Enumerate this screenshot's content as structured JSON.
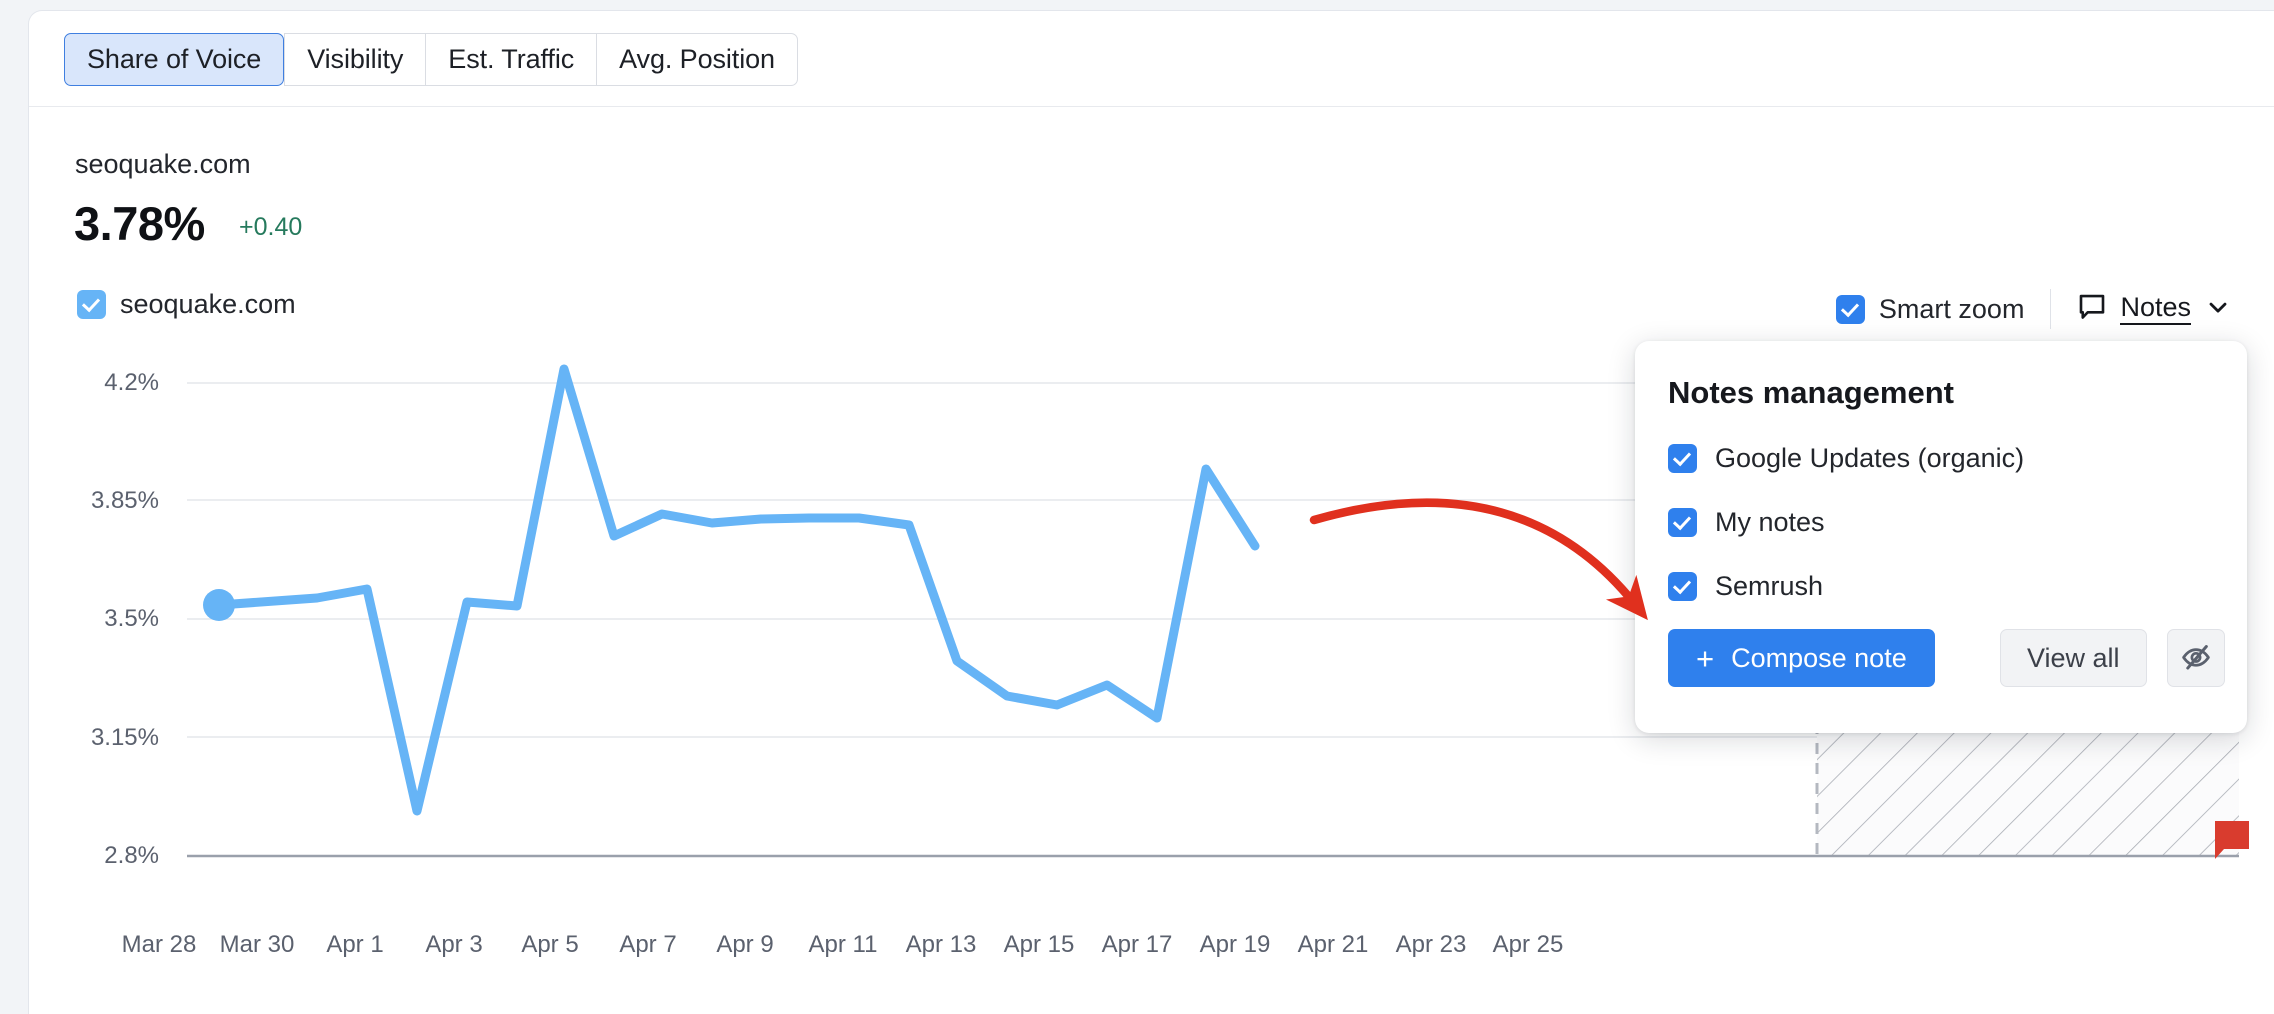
{
  "tabs": [
    {
      "label": "Share of Voice",
      "active": true
    },
    {
      "label": "Visibility",
      "active": false
    },
    {
      "label": "Est. Traffic",
      "active": false
    },
    {
      "label": "Avg. Position",
      "active": false
    }
  ],
  "header": {
    "domain": "seoquake.com",
    "value": "3.78%",
    "delta": "+0.40"
  },
  "legend": {
    "series_label": "seoquake.com",
    "smart_zoom_label": "Smart zoom",
    "notes_label": "Notes"
  },
  "notes_popup": {
    "title": "Notes management",
    "options": [
      {
        "label": "Google Updates (organic)",
        "checked": true
      },
      {
        "label": "My notes",
        "checked": true
      },
      {
        "label": "Semrush",
        "checked": true
      }
    ],
    "compose_label": "Compose note",
    "compose_plus": "+",
    "view_all_label": "View all"
  },
  "colors": {
    "line": "#66b4f6",
    "accent_blue": "#2f80ed",
    "active_tab_bg": "#d9e6fb",
    "active_tab_border": "#3f7fe0",
    "delta_green": "#267a5d",
    "annotation_red": "#e0301e",
    "note_marker_red": "#d93c2e"
  },
  "chart_data": {
    "type": "line",
    "title": "",
    "xlabel": "",
    "ylabel": "",
    "ylim": [
      2.8,
      4.2
    ],
    "yticks": [
      "2.8%",
      "3.15%",
      "3.5%",
      "3.85%",
      "4.2%"
    ],
    "ytick_values": [
      2.8,
      3.15,
      3.5,
      3.85,
      4.2
    ],
    "xticks": [
      "Mar 28",
      "Mar 30",
      "Apr 1",
      "Apr 3",
      "Apr 5",
      "Apr 7",
      "Apr 9",
      "Apr 11",
      "Apr 13",
      "Apr 15",
      "Apr 17",
      "Apr 19",
      "Apr 21",
      "Apr 23",
      "Apr 25"
    ],
    "grid": true,
    "legend_position": "top-left",
    "series": [
      {
        "name": "seoquake.com",
        "color": "#66b4f6",
        "x": [
          "Mar 28",
          "Mar 29",
          "Mar 30",
          "Mar 31",
          "Apr 1",
          "Apr 2",
          "Apr 3",
          "Apr 4",
          "Apr 5",
          "Apr 6",
          "Apr 7",
          "Apr 8",
          "Apr 9",
          "Apr 10",
          "Apr 11",
          "Apr 12",
          "Apr 13",
          "Apr 14",
          "Apr 15",
          "Apr 16",
          "Apr 17"
        ],
        "values": [
          3.55,
          3.57,
          3.6,
          3.02,
          3.53,
          3.52,
          4.13,
          3.67,
          3.73,
          3.71,
          3.72,
          3.72,
          3.72,
          3.7,
          3.33,
          3.24,
          3.22,
          3.27,
          3.18,
          3.83,
          3.62
        ]
      }
    ],
    "start_marker": {
      "x": "Mar 28",
      "y": 3.55
    },
    "forecast_band": {
      "from": "Apr 19",
      "to": "Apr 25",
      "style": "hatched"
    },
    "note_markers": [
      {
        "x": "Apr 25",
        "color": "#d93c2e"
      }
    ]
  },
  "annotation": {
    "type": "curved-arrow",
    "color": "#e0301e",
    "points_to": "compose-note-button"
  }
}
